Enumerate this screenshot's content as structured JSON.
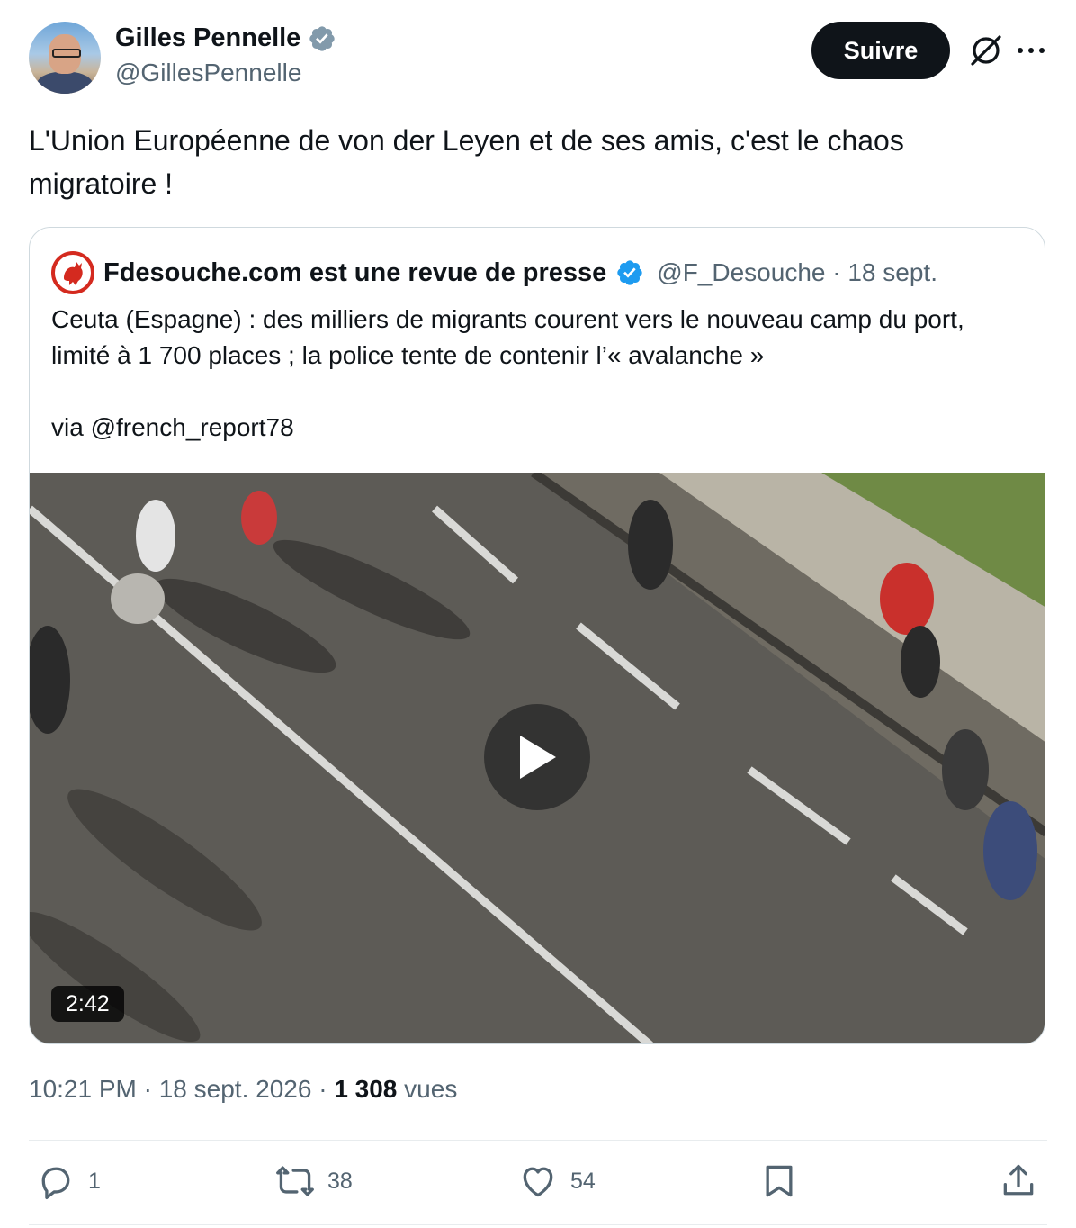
{
  "author": {
    "name": "Gilles Pennelle",
    "handle": "@GillesPennelle"
  },
  "follow_label": "Suivre",
  "tweet_text": "L'Union Européenne de von der Leyen et de ses amis, c'est le chaos migratoire !",
  "quoted": {
    "name": "Fdesouche.com est une revue de presse",
    "handle_date": "@F_Desouche · 18 sept.",
    "text": "Ceuta (Espagne) : des milliers de migrants courent vers le nouveau camp du port, limité à 1 700 places ; la police tente de contenir l’« avalanche »\n\nvia @french_report78",
    "video_duration": "2:42"
  },
  "meta": {
    "time_date": "10:21 PM · 18 sept. 2026 · ",
    "views_count": "1 308",
    "views_label": " vues"
  },
  "actions": {
    "replies": "1",
    "reposts": "38",
    "likes": "54"
  },
  "colors": {
    "verified": "#1d9bf0",
    "secondary_text": "#536471",
    "button_bg": "#0f1419"
  },
  "icons": [
    "verified-badge-icon",
    "grok-icon",
    "more-icon",
    "play-icon",
    "reply-icon",
    "repost-icon",
    "like-icon",
    "bookmark-icon",
    "share-icon"
  ]
}
